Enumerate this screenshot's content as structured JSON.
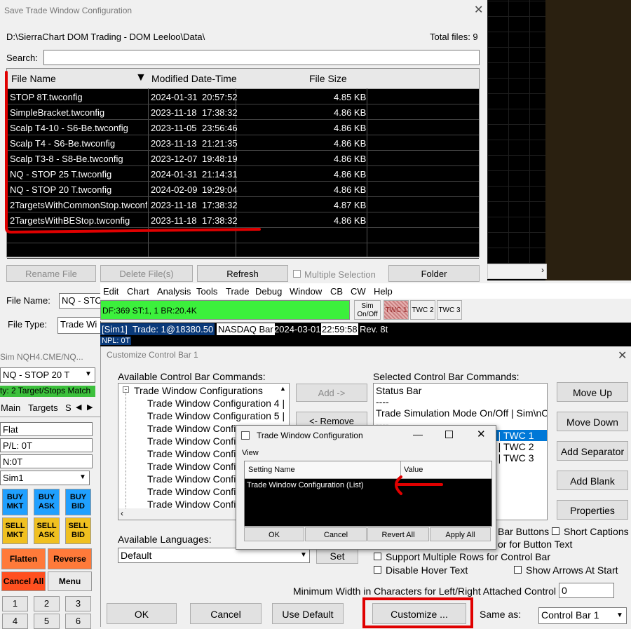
{
  "save_dialog": {
    "title": "Save Trade Window Configuration",
    "path": "D:\\SierraChart DOM Trading - DOM Leeloo\\Data\\",
    "total_files": "Total files: 9",
    "search_label": "Search:",
    "search_value": "",
    "columns": [
      "File Name",
      "Modified Date-Time",
      "File Size"
    ],
    "sort_arrow": "▼",
    "files": [
      {
        "name": "STOP 8T.twconfig",
        "date": "2024-01-31",
        "time": "20:57:52",
        "size": "4.85 KB"
      },
      {
        "name": "SimpleBracket.twconfig",
        "date": "2023-11-18",
        "time": "17:38:32",
        "size": "4.86 KB"
      },
      {
        "name": "Scalp T4-10 - S6-Be.twconfig",
        "date": "2023-11-05",
        "time": "23:56:46",
        "size": "4.86 KB"
      },
      {
        "name": "Scalp T4 - S6-Be.twconfig",
        "date": "2023-11-13",
        "time": "21:21:35",
        "size": "4.86 KB"
      },
      {
        "name": "Scalp T3-8 - S8-Be.twconfig",
        "date": "2023-12-07",
        "time": "19:48:19",
        "size": "4.86 KB"
      },
      {
        "name": "NQ - STOP 25 T.twconfig",
        "date": "2024-01-31",
        "time": "21:14:31",
        "size": "4.86 KB"
      },
      {
        "name": "NQ - STOP 20 T.twconfig",
        "date": "2024-02-09",
        "time": "19:29:04",
        "size": "4.86 KB"
      },
      {
        "name": "2TargetsWithCommonStop.twconfig",
        "date": "2023-11-18",
        "time": "17:38:32",
        "size": "4.87 KB"
      },
      {
        "name": "2TargetsWithBEStop.twconfig",
        "date": "2023-11-18",
        "time": "17:38:32",
        "size": "4.86 KB"
      }
    ],
    "buttons": {
      "rename": "Rename File",
      "delete": "Delete File(s)",
      "refresh": "Refresh",
      "multi": "Multiple Selection",
      "folder": "Folder"
    },
    "file_name_label": "File Name:",
    "file_name_value": "NQ - STO",
    "file_type_label": "File Type:",
    "file_type_value": "Trade Wi"
  },
  "menu": {
    "items": [
      "Edit",
      "Chart",
      "Analysis",
      "Tools",
      "Trade",
      "Debug",
      "Window",
      "CB",
      "CW",
      "Help"
    ],
    "status": "DF:369  ST:1, 1  BR:20.4K",
    "sim_btn": [
      "Sim",
      "On/Off"
    ],
    "twc": [
      "TWC 1",
      "TWC 2",
      "TWC 3"
    ]
  },
  "chart_bar": {
    "sim": "[Sim1]",
    "trade": "Trade: 1@18380.50",
    "symbol": "NASDAQ Bar",
    "date": "2024-03-01",
    "time": "22:59:58",
    "rev": "Rev. 8t",
    "npl": "NPL: 0T"
  },
  "trade_panel": {
    "title": "Sim NQH4.CME/NQ...",
    "config": "NQ - STOP 20 T",
    "banner": "ty: 2 Target/Stops Match",
    "tabs": [
      "Main",
      "Targets",
      "S"
    ],
    "position": "Flat",
    "pl": "P/L: 0T",
    "n": "N:0T",
    "account": "Sim1",
    "buy": [
      [
        "BUY",
        "MKT"
      ],
      [
        "BUY",
        "ASK"
      ],
      [
        "BUY",
        "BID"
      ]
    ],
    "sell": [
      [
        "SELL",
        "MKT"
      ],
      [
        "SELL",
        "ASK"
      ],
      [
        "SELL",
        "BID"
      ]
    ],
    "flatten": "Flatten",
    "reverse": "Reverse",
    "cancel_all": "Cancel All",
    "menu": "Menu",
    "nums": [
      "1",
      "2",
      "3",
      "4",
      "5",
      "6"
    ]
  },
  "customize": {
    "title": "Customize Control Bar 1",
    "available_label": "Available Control Bar Commands:",
    "tree_root": "Trade Window Configurations",
    "tree_items": [
      "Trade Window Configuration 4 |",
      "Trade Window Configuration 5 |",
      "Trade Window Configu",
      "Trade Window Configu",
      "Trade Window Configu",
      "Trade Window Configu",
      "Trade Window Configu",
      "Trade Window Configu",
      "Trade Window Configu"
    ],
    "add": "Add ->",
    "remove": "<- Remove",
    "selected_label": "Selected Control Bar Commands:",
    "selected_items": [
      "Status Bar",
      "----",
      "Trade Simulation Mode On/Off | Sim\\nOn/",
      "----",
      "1 | TWC 1",
      "2 | TWC 2",
      "3 | TWC 3"
    ],
    "right_buttons": [
      "Move Up",
      "Move Down",
      "Add Separator",
      "Add Blank",
      "Properties"
    ],
    "bar_buttons": "Bar Buttons",
    "short_captions": "Short Captions",
    "button_text": "or for Button Text",
    "support_multiple": "Support Multiple Rows for Control Bar",
    "disable_hover": "Disable Hover Text",
    "show_arrows": "Show Arrows At Start",
    "languages_label": "Available Languages:",
    "language_value": "Default",
    "set": "Set",
    "min_width_label": "Minimum Width in Characters for Left/Right Attached Control Bar:",
    "min_width_value": "0",
    "ok": "OK",
    "cancel": "Cancel",
    "use_default": "Use Default",
    "customize_btn": "Customize ...",
    "same_as": "Same as:",
    "same_as_value": "Control Bar 1"
  },
  "twc_dialog": {
    "title": "Trade Window Configuration",
    "view": "View",
    "col_name": "Setting Name",
    "col_value": "Value",
    "row": "Trade Window Configuration (List)",
    "ok": "OK",
    "cancel": "Cancel",
    "revert": "Revert All",
    "apply": "Apply All"
  },
  "colors": {
    "highlight_red": "#e00000",
    "status_green": "#3cf03c",
    "selected_blue": "#0078d7"
  }
}
